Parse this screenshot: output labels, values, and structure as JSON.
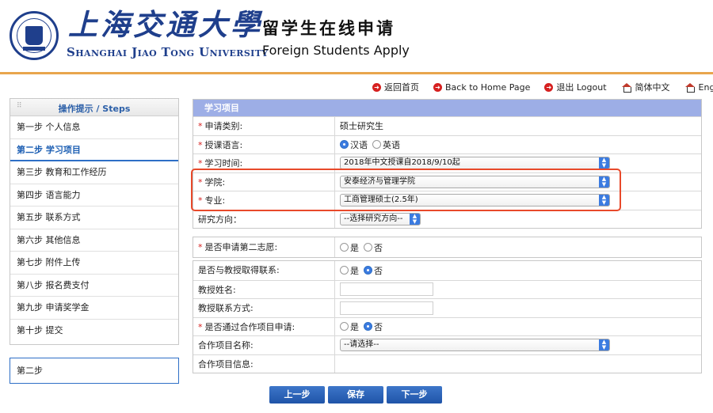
{
  "header": {
    "cn_logo": "上海交通大學",
    "en_logo": "Shanghai Jiao Tong University",
    "app_title_cn": "留学生在线申请",
    "app_title_en": "Foreign Students Apply"
  },
  "toplinks": {
    "back_cn": "返回首页",
    "back_en": "Back to Home Page",
    "logout": "退出 Logout",
    "chinese": "简体中文",
    "english": "English"
  },
  "sidebar": {
    "title": "操作提示 / Steps",
    "grip": "⠿",
    "steps": [
      "第一步 个人信息",
      "第二步 学习项目",
      "第三步 教育和工作经历",
      "第四步 语言能力",
      "第五步 联系方式",
      "第六步 其他信息",
      "第七步 附件上传",
      "第八步 报名费支付",
      "第九步 申请奖学金",
      "第十步 提交"
    ],
    "active_index": 1,
    "current": "第二步"
  },
  "form": {
    "panel_title": "学习项目",
    "required_mark": "*",
    "apply_type_label": "申请类别:",
    "apply_type_value": "硕士研究生",
    "language_label": "授课语言:",
    "language_options": [
      "汉语",
      "英语"
    ],
    "language_selected": "汉语",
    "study_time_label": "学习时间:",
    "study_time_value": "2018年中文授课自2018/9/10起",
    "college_label": "学院:",
    "college_value": "安泰经济与管理学院",
    "major_label": "专业:",
    "major_value": "工商管理硕士(2.5年)",
    "direction_label": "研究方向：",
    "direction_value": "--选择研究方向--",
    "second_choice_label": "是否申请第二志愿:",
    "second_choice_options": [
      "是",
      "否"
    ],
    "contact_prof_label": "是否与教授取得联系:",
    "contact_prof_options": [
      "是",
      "否"
    ],
    "contact_prof_selected": "否",
    "prof_name_label": "教授姓名:",
    "prof_contact_label": "教授联系方式:",
    "coop_label": "是否通过合作项目申请:",
    "coop_options": [
      "是",
      "否"
    ],
    "coop_selected": "否",
    "coop_name_label": "合作项目名称:",
    "coop_name_value": "--请选择--",
    "coop_info_label": "合作项目信息:"
  },
  "buttons": {
    "prev": "上一步",
    "save": "保存",
    "next": "下一步"
  },
  "colors": {
    "brand_blue": "#1f3f8c",
    "divider_orange": "#e8a54d",
    "panel_header": "#9daee6",
    "required_red": "#d6201f",
    "highlight_red": "#e8492a",
    "button_blue": "#2a62b8"
  }
}
